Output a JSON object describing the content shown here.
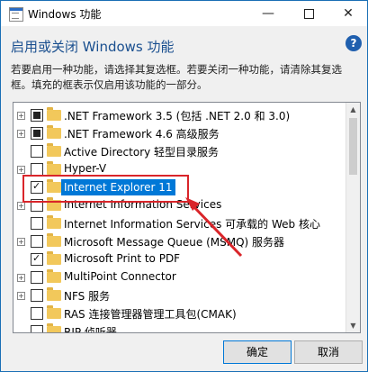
{
  "window": {
    "title": "Windows 功能"
  },
  "heading": "启用或关闭 Windows 功能",
  "description": "若要启用一种功能，请选择其复选框。若要关闭一种功能，请清除其复选框。填充的框表示仅启用该功能的一部分。",
  "features": [
    {
      "label": ".NET Framework 3.5 (包括 .NET 2.0 和 3.0)",
      "expandable": true,
      "state": "partial",
      "selected": false
    },
    {
      "label": ".NET Framework 4.6 高级服务",
      "expandable": true,
      "state": "partial",
      "selected": false
    },
    {
      "label": "Active Directory 轻型目录服务",
      "expandable": false,
      "state": "unchecked",
      "selected": false
    },
    {
      "label": "Hyper-V",
      "expandable": true,
      "state": "unchecked",
      "selected": false
    },
    {
      "label": "Internet Explorer 11",
      "expandable": false,
      "state": "checked",
      "selected": true
    },
    {
      "label": "Internet Information Services",
      "expandable": true,
      "state": "unchecked",
      "selected": false
    },
    {
      "label": "Internet Information Services 可承载的 Web 核心",
      "expandable": false,
      "state": "unchecked",
      "selected": false
    },
    {
      "label": "Microsoft Message Queue (MSMQ) 服务器",
      "expandable": true,
      "state": "unchecked",
      "selected": false
    },
    {
      "label": "Microsoft Print to PDF",
      "expandable": false,
      "state": "checked",
      "selected": false
    },
    {
      "label": "MultiPoint Connector",
      "expandable": true,
      "state": "unchecked",
      "selected": false
    },
    {
      "label": "NFS 服务",
      "expandable": true,
      "state": "unchecked",
      "selected": false
    },
    {
      "label": "RAS 连接管理器管理工具包(CMAK)",
      "expandable": false,
      "state": "unchecked",
      "selected": false
    },
    {
      "label": "RIP 侦听器",
      "expandable": false,
      "state": "unchecked",
      "selected": false
    }
  ],
  "buttons": {
    "ok": "确定",
    "cancel": "取消"
  },
  "icons": {
    "help": "help-icon",
    "folder": "folder-icon"
  },
  "colors": {
    "accent": "#0078d7",
    "annotation": "#d9252a",
    "heading": "#1a4f8f"
  }
}
